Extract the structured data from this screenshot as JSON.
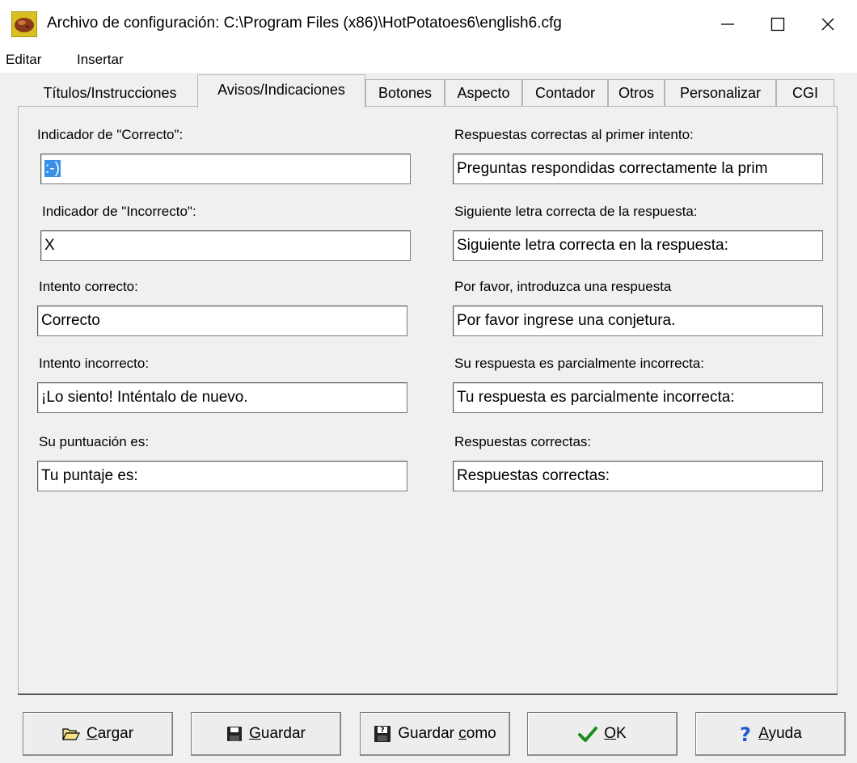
{
  "window": {
    "title": "Archivo de configuración: C:\\Program Files (x86)\\HotPotatoes6\\english6.cfg",
    "minimize": "—",
    "maximize": "☐",
    "close": "✕"
  },
  "menu": [
    "Editar",
    "Insertar"
  ],
  "tabs": [
    {
      "label": "Títulos/Instrucciones",
      "active": false
    },
    {
      "label": "Avisos/Indicaciones",
      "active": true
    },
    {
      "label": "Botones",
      "active": false
    },
    {
      "label": "Aspecto",
      "active": false
    },
    {
      "label": "Contador",
      "active": false
    },
    {
      "label": "Otros",
      "active": false
    },
    {
      "label": "Personalizar",
      "active": false
    },
    {
      "label": "CGI",
      "active": false
    }
  ],
  "fields_left": [
    {
      "label": "Indicador de \"Correcto\":",
      "value": ":-)"
    },
    {
      "label": "Indicador de \"Incorrecto\":",
      "value": "X"
    },
    {
      "label": "Intento correcto:",
      "value": "Correcto"
    },
    {
      "label": "Intento incorrecto:",
      "value": "¡Lo siento! Inténtalo de nuevo."
    },
    {
      "label": "Su puntuación es:",
      "value": "Tu puntaje es:"
    }
  ],
  "fields_right": [
    {
      "label": "Respuestas correctas al primer intento:",
      "value": "Preguntas respondidas correctamente la prim"
    },
    {
      "label": "Siguiente letra correcta de la respuesta:",
      "value": "Siguiente letra correcta en la respuesta:"
    },
    {
      "label": "Por favor, introduzca una respuesta",
      "value": "Por favor ingrese una conjetura."
    },
    {
      "label": "Su respuesta es parcialmente incorrecta:",
      "value": "Tu respuesta es parcialmente incorrecta:"
    },
    {
      "label": "Respuestas correctas:",
      "value": "Respuestas correctas:"
    }
  ],
  "buttons": {
    "load": {
      "accel": "C",
      "rest": "argar",
      "icon": "open-folder-icon"
    },
    "save": {
      "accel": "G",
      "rest": "uardar",
      "icon": "floppy-disk-icon"
    },
    "save_as": {
      "pre": "Guardar ",
      "accel": "c",
      "rest": "omo",
      "icon": "save-as-icon"
    },
    "ok": {
      "accel": "O",
      "rest": "K",
      "icon": "checkmark-icon"
    },
    "help": {
      "accel": "A",
      "rest": "yuda",
      "icon": "question-mark-icon"
    }
  },
  "colors": {
    "selection": "#3a8fe8",
    "check": "#1a8c1a",
    "help": "#1e5ad2"
  }
}
